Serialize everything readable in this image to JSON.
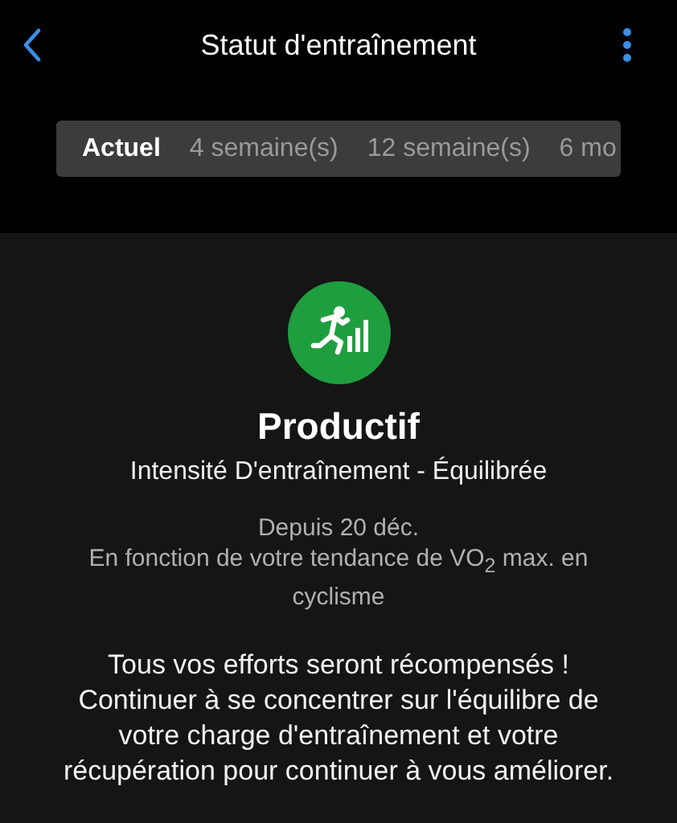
{
  "header": {
    "title": "Statut d'entraînement"
  },
  "tabs": [
    {
      "label": "Actuel",
      "selected": true
    },
    {
      "label": "4 semaine(s)",
      "selected": false
    },
    {
      "label": "12 semaine(s)",
      "selected": false
    },
    {
      "label": "6 mo",
      "selected": false
    }
  ],
  "status": {
    "title": "Productif",
    "color": "#1e9e3e",
    "intensity": "Intensité D'entraînement - Équilibrée",
    "since": "Depuis 20 déc.",
    "basis": "En fonction de votre tendance de VO$_{2}$ max. en cyclisme",
    "message": "Tous vos efforts seront récompensés ! Continuer à se concentrer sur l'équilibre de votre charge d'entraînement et votre récupération pour continuer à vous améliorer."
  }
}
